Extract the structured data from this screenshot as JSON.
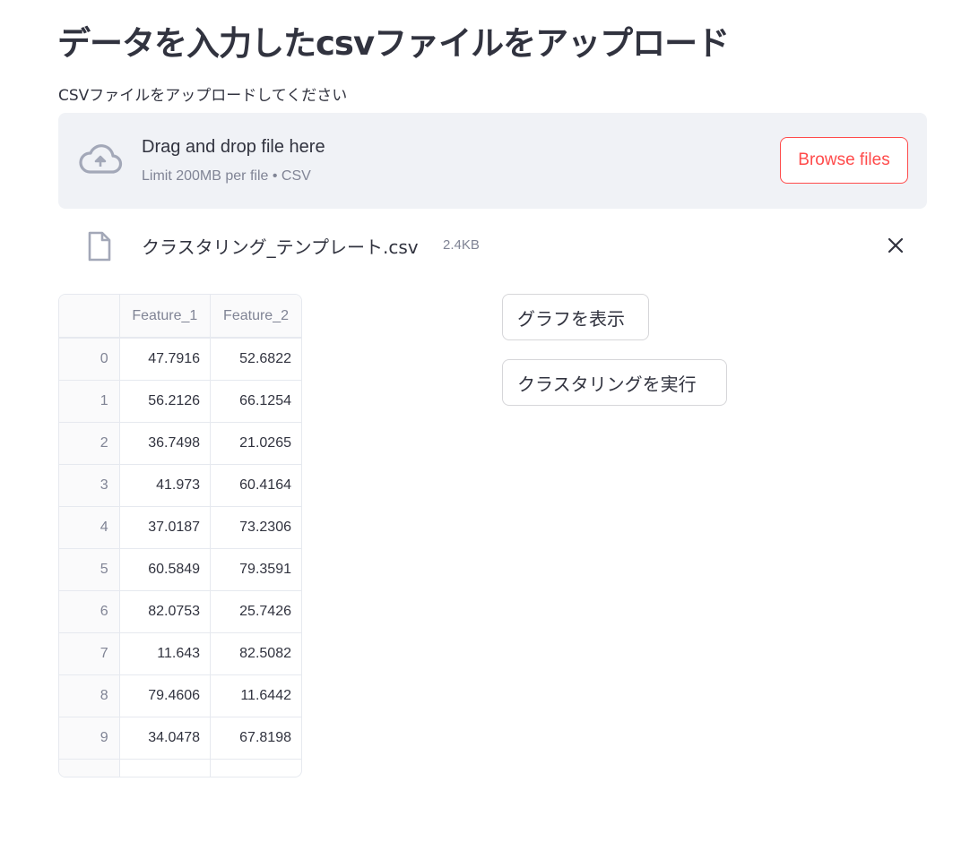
{
  "page": {
    "title": "データを入力したcsvファイルをアップロード"
  },
  "uploader": {
    "label": "CSVファイルをアップロードしてください",
    "drop_text": "Drag and drop file here",
    "limit_text": "Limit 200MB per file • CSV",
    "browse_label": "Browse files",
    "icon": "cloud-upload-icon",
    "accent_color": "#ff4b4b"
  },
  "file": {
    "name": "クラスタリング_テンプレート.csv",
    "size": "2.4KB",
    "icon": "file-icon",
    "remove_icon": "close-icon"
  },
  "dataframe": {
    "columns": [
      "",
      "Feature_1",
      "Feature_2"
    ],
    "rows": [
      [
        "0",
        "47.7916",
        "52.6822"
      ],
      [
        "1",
        "56.2126",
        "66.1254"
      ],
      [
        "2",
        "36.7498",
        "21.0265"
      ],
      [
        "3",
        "41.973",
        "60.4164"
      ],
      [
        "4",
        "37.0187",
        "73.2306"
      ],
      [
        "5",
        "60.5849",
        "79.3591"
      ],
      [
        "6",
        "82.0753",
        "25.7426"
      ],
      [
        "7",
        "11.643",
        "82.5082"
      ],
      [
        "8",
        "79.4606",
        "11.6442"
      ],
      [
        "9",
        "34.0478",
        "67.8198"
      ],
      [
        "",
        "",
        ""
      ]
    ]
  },
  "actions": {
    "show_graph": "グラフを表示",
    "run_clustering": "クラスタリングを実行"
  }
}
